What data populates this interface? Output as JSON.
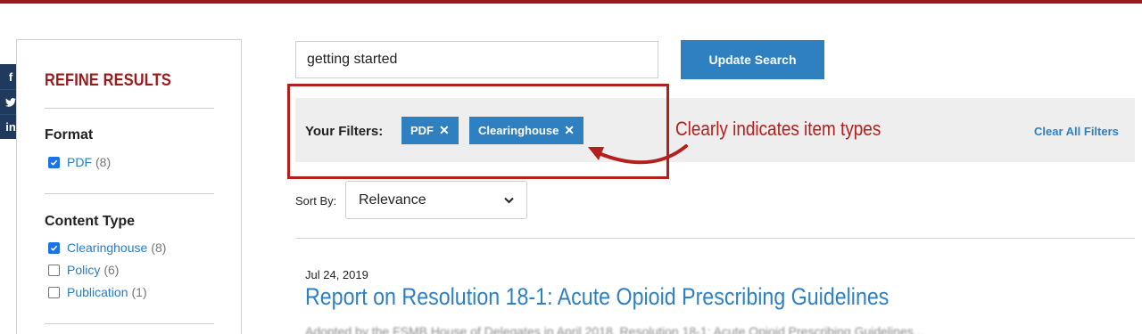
{
  "theme": {
    "brand_red": "#9b1b1b",
    "link_blue": "#2f80c1",
    "annotation_red": "#b3201c",
    "social_navy": "#1f3a5c"
  },
  "social": [
    {
      "icon": "facebook-icon",
      "glyph": "f"
    },
    {
      "icon": "twitter-icon",
      "glyph": "t"
    },
    {
      "icon": "linkedin-icon",
      "glyph": "in"
    }
  ],
  "sidebar": {
    "heading": "REFINE RESULTS",
    "facets": [
      {
        "title": "Format",
        "items": [
          {
            "label": "PDF",
            "count": "(8)",
            "checked": true
          }
        ]
      },
      {
        "title": "Content Type",
        "items": [
          {
            "label": "Clearinghouse",
            "count": "(8)",
            "checked": true
          },
          {
            "label": "Policy",
            "count": "(6)",
            "checked": false
          },
          {
            "label": "Publication",
            "count": "(1)",
            "checked": false
          }
        ]
      }
    ]
  },
  "search": {
    "value": "getting started",
    "button_label": "Update Search"
  },
  "filters": {
    "label": "Your Filters:",
    "chips": [
      {
        "label": "PDF",
        "remove": "✕"
      },
      {
        "label": "Clearinghouse",
        "remove": "✕"
      }
    ],
    "clear_all": "Clear All Filters"
  },
  "annotation": {
    "text": "Clearly indicates item types"
  },
  "sort": {
    "label": "Sort By:",
    "selected": "Relevance"
  },
  "results": [
    {
      "date": "Jul 24, 2019",
      "title": "Report on Resolution 18-1: Acute Opioid Prescribing Guidelines"
    }
  ]
}
